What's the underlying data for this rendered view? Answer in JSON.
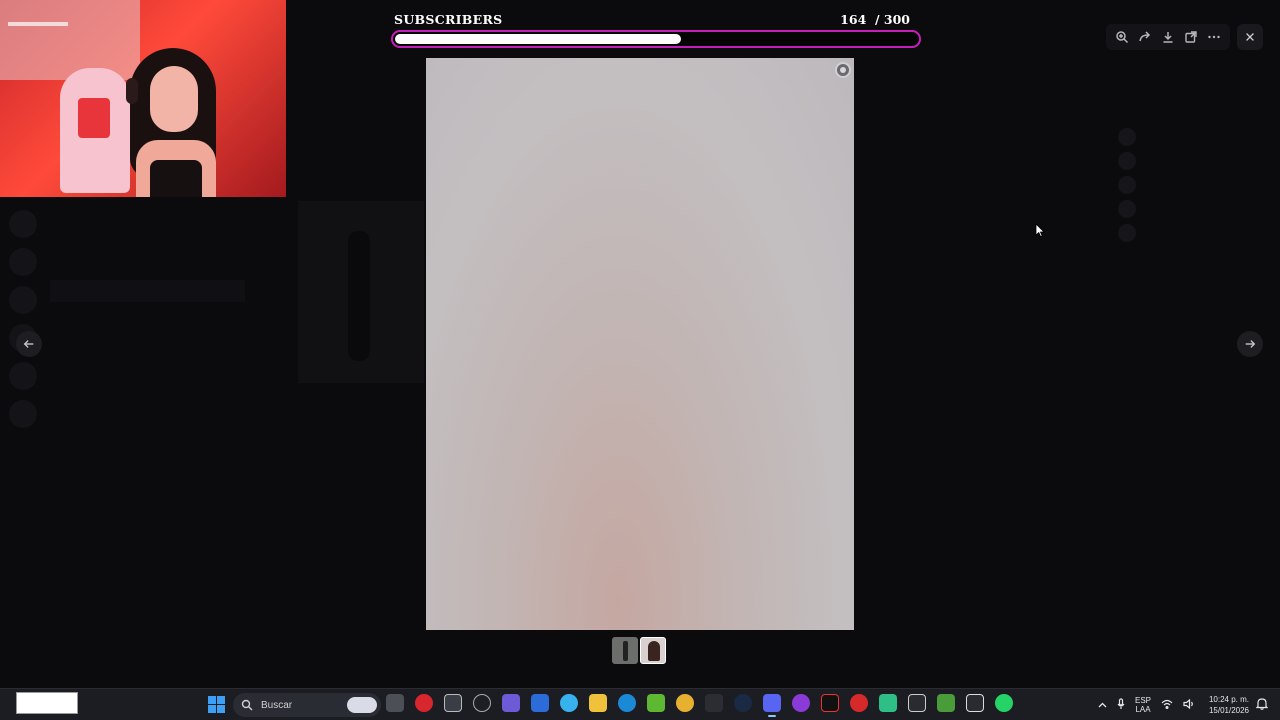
{
  "goal": {
    "label": "SUBSCRIBERS",
    "current": "164",
    "target": "/ 300",
    "progress": 0.547
  },
  "viewer": {
    "toolbar_icons": [
      "zoom-in-icon",
      "forward-icon",
      "download-icon",
      "open-external-icon",
      "more-icon"
    ],
    "close_icon": "close-icon",
    "prev_icon": "arrow-left-icon",
    "next_icon": "arrow-right-icon",
    "thumbnails": 2
  },
  "taskbar": {
    "search_placeholder": "Buscar",
    "lang_line1": "ESP",
    "lang_line2": "LAA",
    "time": "10:24 p. m.",
    "date": "15/01/2026",
    "accent": "#3ea0f5"
  }
}
